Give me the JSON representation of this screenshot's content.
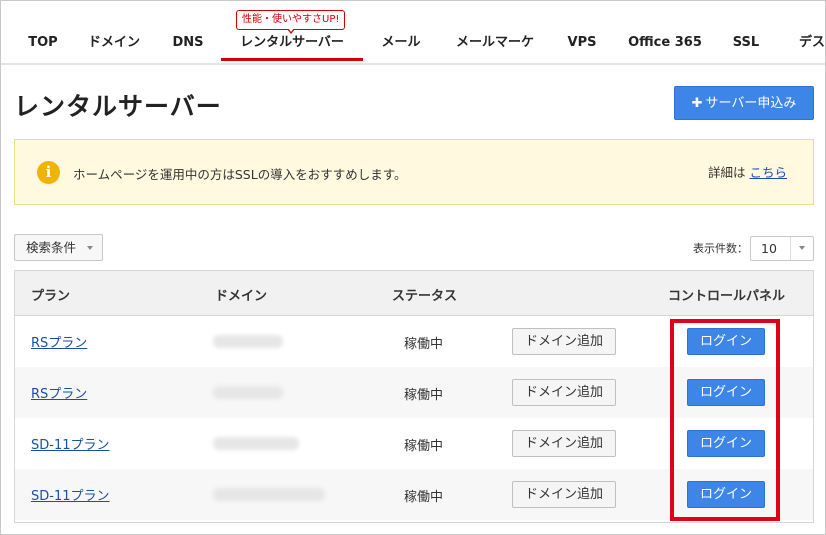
{
  "nav": {
    "promo_badge": "性能・使いやすさUP!",
    "items": [
      "TOP",
      "ドメイン",
      "DNS",
      "レンタルサーバー",
      "メール",
      "メールマーケ",
      "VPS",
      "Office 365",
      "SSL",
      "デス"
    ],
    "active_index": 3
  },
  "header": {
    "title": "レンタルサーバー",
    "apply_button": "サーバー申込み",
    "apply_icon": "plus-icon"
  },
  "notice": {
    "icon": "info-icon",
    "icon_glyph": "i",
    "text": "ホームページを運用中の方はSSLの導入をおすすめします。",
    "detail_prefix": "詳細は",
    "detail_link": "こちら"
  },
  "filters": {
    "search_conditions": "検索条件",
    "display_count_label": "表示件数：",
    "display_count_value": "10"
  },
  "table": {
    "columns": [
      "プラン",
      "ドメイン",
      "ステータス",
      "コントロールパネル"
    ],
    "rows": [
      {
        "plan": "RSプラン",
        "status": "稼働中",
        "add_domain": "ドメイン追加",
        "login": "ログイン"
      },
      {
        "plan": "RSプラン",
        "status": "稼働中",
        "add_domain": "ドメイン追加",
        "login": "ログイン"
      },
      {
        "plan": "SD-11プラン",
        "status": "稼働中",
        "add_domain": "ドメイン追加",
        "login": "ログイン"
      },
      {
        "plan": "SD-11プラン",
        "status": "稼働中",
        "add_domain": "ドメイン追加",
        "login": "ログイン"
      }
    ]
  },
  "colors": {
    "accent_blue": "#3d86e8",
    "nav_active": "#d20000",
    "highlight": "#e0001a",
    "notice_bg": "#fff9e0",
    "info_icon": "#f0b400",
    "link": "#1a4fa8"
  }
}
